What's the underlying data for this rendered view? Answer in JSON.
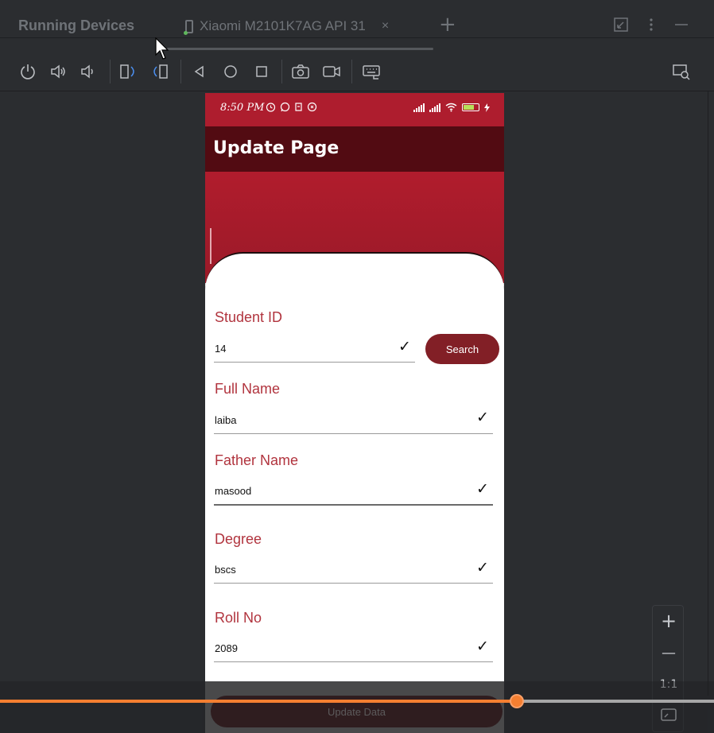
{
  "ide": {
    "tool_window_title": "Running Devices",
    "device_tab": "Xiaomi M2101K7AG API 31",
    "tab_close": "×",
    "add_tab": "+",
    "toolbar_icons": [
      "power-icon",
      "volume-up-icon",
      "volume-down-icon",
      "rotate-left-icon",
      "rotate-right-icon",
      "back-icon",
      "home-icon",
      "overview-icon",
      "screenshot-icon",
      "screen-record-icon",
      "keyboard-icon"
    ]
  },
  "status_bar": {
    "time": "8:50 PM",
    "icons": [
      "alarm-icon",
      "whatsapp-icon",
      "notification-icon",
      "clock-icon"
    ],
    "battery_level": 0.7
  },
  "app": {
    "title": "Update Page",
    "fields": [
      {
        "label": "Student ID",
        "value": "14"
      },
      {
        "label": "Full Name",
        "value": "laiba"
      },
      {
        "label": "Father Name",
        "value": "masood"
      },
      {
        "label": "Degree",
        "value": "bscs"
      },
      {
        "label": "Roll No",
        "value": "2089"
      }
    ],
    "search_button": "Search",
    "update_button": "Update Data"
  },
  "zoom": {
    "zoom_in": "+",
    "zoom_out": "—",
    "reset": "1:1"
  },
  "playback": {
    "progress": 0.724
  },
  "colors": {
    "status_bar": "#ae1d2e",
    "app_bar": "#520b12",
    "label": "#b1343e",
    "button": "#821f26",
    "progress": "#f57f31"
  }
}
